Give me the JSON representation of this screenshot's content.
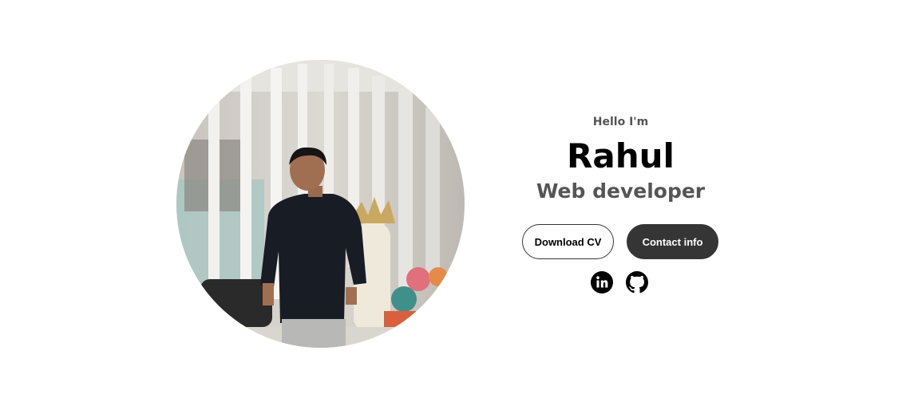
{
  "hero": {
    "greeting": "Hello I'm",
    "name": "Rahul",
    "role": "Web developer",
    "buttons": {
      "download_cv": "Download CV",
      "contact_info": "Contact info"
    }
  },
  "socials": [
    {
      "icon": "linkedin-icon"
    },
    {
      "icon": "github-icon"
    }
  ],
  "colors": {
    "button_dark": "#353535",
    "text_primary": "#000000",
    "text_secondary": "#555555",
    "background": "#ffffff"
  }
}
